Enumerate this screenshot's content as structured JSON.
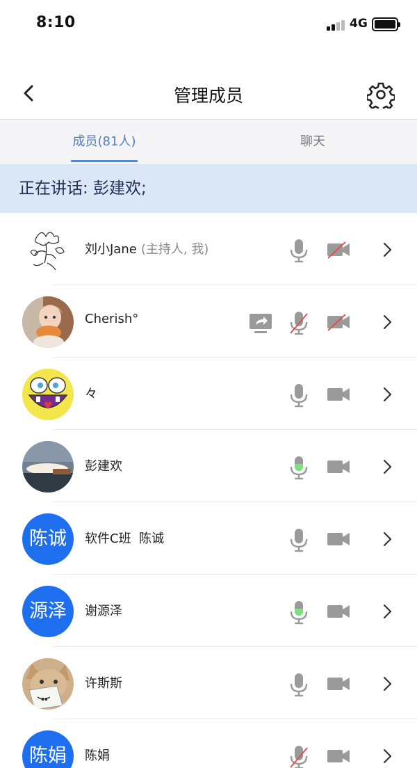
{
  "status_bar": {
    "time": "8:10",
    "network": "4G"
  },
  "nav": {
    "title": "管理成员"
  },
  "tabs": [
    {
      "label": "成员(81人)",
      "active": true
    },
    {
      "label": "聊天",
      "active": false
    }
  ],
  "speaking": {
    "text": "正在讲话: 彭建欢;"
  },
  "colors": {
    "accent": "#4f7cc7",
    "banner": "#dbe6f7",
    "avatar_blue": "#1e6ff0",
    "speaking_green": "#7ee07e",
    "mute_red": "#e05050",
    "icon_gray": "#9a9a9a"
  },
  "members": [
    {
      "name": "刘小Jane",
      "role": "(主持人, 我)",
      "avatar_type": "sketch-flower",
      "mic": "on",
      "camera": "off",
      "sharing": false
    },
    {
      "name": "Cherish°",
      "role": "",
      "avatar_type": "photo-child",
      "mic": "off",
      "camera": "off",
      "sharing": true
    },
    {
      "name": "々",
      "role": "",
      "avatar_type": "cartoon-sponge",
      "mic": "on",
      "camera": "on",
      "sharing": false
    },
    {
      "name": "彭建欢",
      "role": "",
      "avatar_type": "photo-sunset",
      "mic": "speaking",
      "camera": "on",
      "sharing": false
    },
    {
      "name": "软件C班  陈诚",
      "role": "",
      "avatar_type": "text",
      "avatar_text": "陈诚",
      "mic": "on",
      "camera": "on",
      "sharing": false
    },
    {
      "name": "谢源泽",
      "role": "",
      "avatar_type": "text",
      "avatar_text": "源泽",
      "mic": "speaking",
      "camera": "on",
      "sharing": false
    },
    {
      "name": "许斯斯",
      "role": "",
      "avatar_type": "photo-cat",
      "mic": "on",
      "camera": "on",
      "sharing": false
    },
    {
      "name": "陈娟",
      "role": "",
      "avatar_type": "text",
      "avatar_text": "陈娟",
      "mic": "off",
      "camera": "on",
      "sharing": false
    }
  ]
}
